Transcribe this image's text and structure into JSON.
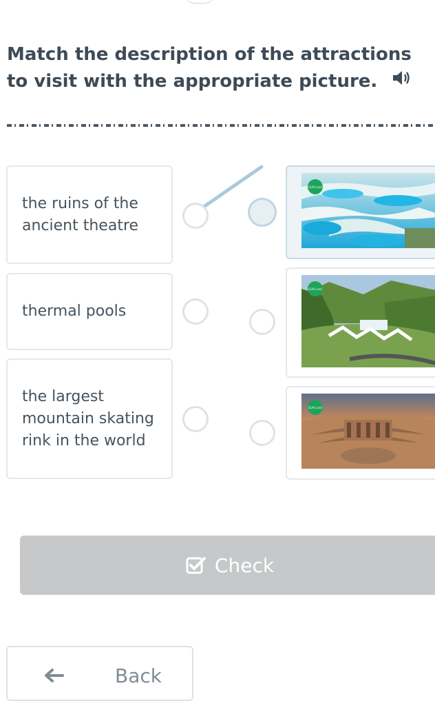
{
  "task": {
    "instruction": "Match the description of the attractions to visit with the appropriate picture."
  },
  "icons": {
    "audio": "speaker-icon",
    "check": "checkbox-check-icon",
    "back": "arrow-left-icon",
    "watermark": "logo-badge-icon"
  },
  "descriptions": [
    {
      "text": "the ruins of the ancient theatre"
    },
    {
      "text": "thermal pools"
    },
    {
      "text": "the largest mountain skating rink in the world"
    }
  ],
  "pictures": [
    {
      "subject": "turquoise travertine thermal pools",
      "selected": true
    },
    {
      "subject": "mountain valley with skating rink",
      "selected": false
    },
    {
      "subject": "ancient amphitheatre ruins at sunset",
      "selected": false
    }
  ],
  "watermark": {
    "text": "GLM Land"
  },
  "buttons": {
    "check_label": "Check",
    "back_label": "Back"
  },
  "colors": {
    "accent": "#9fc4d6",
    "disabled_button": "#c6c8ca",
    "text": "#3e4b56",
    "logo_green": "#1fa35a"
  }
}
